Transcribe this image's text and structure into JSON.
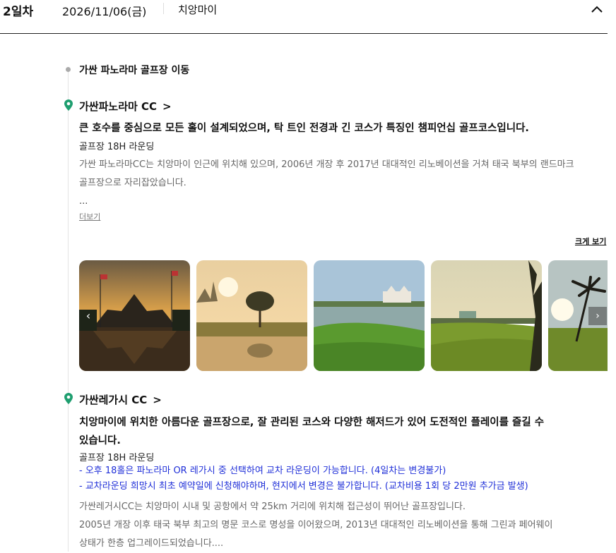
{
  "header": {
    "day": "2일차",
    "date": "2026/11/06(금)",
    "city": "치앙마이"
  },
  "move": {
    "title": "가싼 파노라마 골프장 이동"
  },
  "course1": {
    "name": "가싼파노라마 CC",
    "headline": "큰 호수를 중심으로 모든 홀이 설계되었으며, 탁 트인 전경과 긴 코스가 특징인 챔피언십 골프코스입니다.",
    "round": "골프장 18H 라운딩",
    "description_1": "가싼 파노라마CC는 치앙마이 인근에 위치해 있으며, 2006년 개장 후 2017년 대대적인 리노베이션을 거쳐 태국 북부의 랜드마크",
    "description_2": "골프장으로 자리잡았습니다.",
    "ellipsis": "...",
    "more": "더보기",
    "view_large": "크게 보기",
    "photos": [
      "palace-reflection-photo",
      "sunset-tree-photo",
      "lake-clubhouse-photo",
      "fairway-clubhouse-photo",
      "palm-tree-photo"
    ]
  },
  "course2": {
    "name": "가싼레가시 CC",
    "headline_1": "치앙마이에 위치한 아름다운 골프장으로, 잘 관리된 코스와 다양한 해저드가 있어 도전적인 플레이를 즐길 수",
    "headline_2": "있습니다.",
    "round": "골프장 18H 라운딩",
    "note_1": "- 오후 18홀은 파노라마 OR 레가시 중 선택하여 교차 라운딩이 가능합니다. (4일차는 변경불가)",
    "note_2": "- 교차라운딩 희망시 최초 예약일에 신청해야하며, 현지에서 변경은 불가합니다. (교차비용 1회 당 2만원 추가금 발생)",
    "description_1": "가싼레거시CC는 치앙마이 시내 및 공항에서 약 25km 거리에 위치해 접근성이 뛰어난 골프장입니다.",
    "description_2": "2005년 개장 이후 태국 북부 최고의 명문 코스로 명성을 이어왔으며, 2013년 대대적인 리노베이션을 통해 그린과 페어웨이",
    "description_3": "상태가 한층 업그레이드되었습니다...."
  },
  "icons": {
    "collapse": "chevron-up-icon",
    "location": "map-pin-icon",
    "prev": "chevron-left-icon",
    "next": "chevron-right-icon"
  },
  "colors": {
    "pin": "#1e9e6f",
    "note": "#1f2fd8"
  }
}
